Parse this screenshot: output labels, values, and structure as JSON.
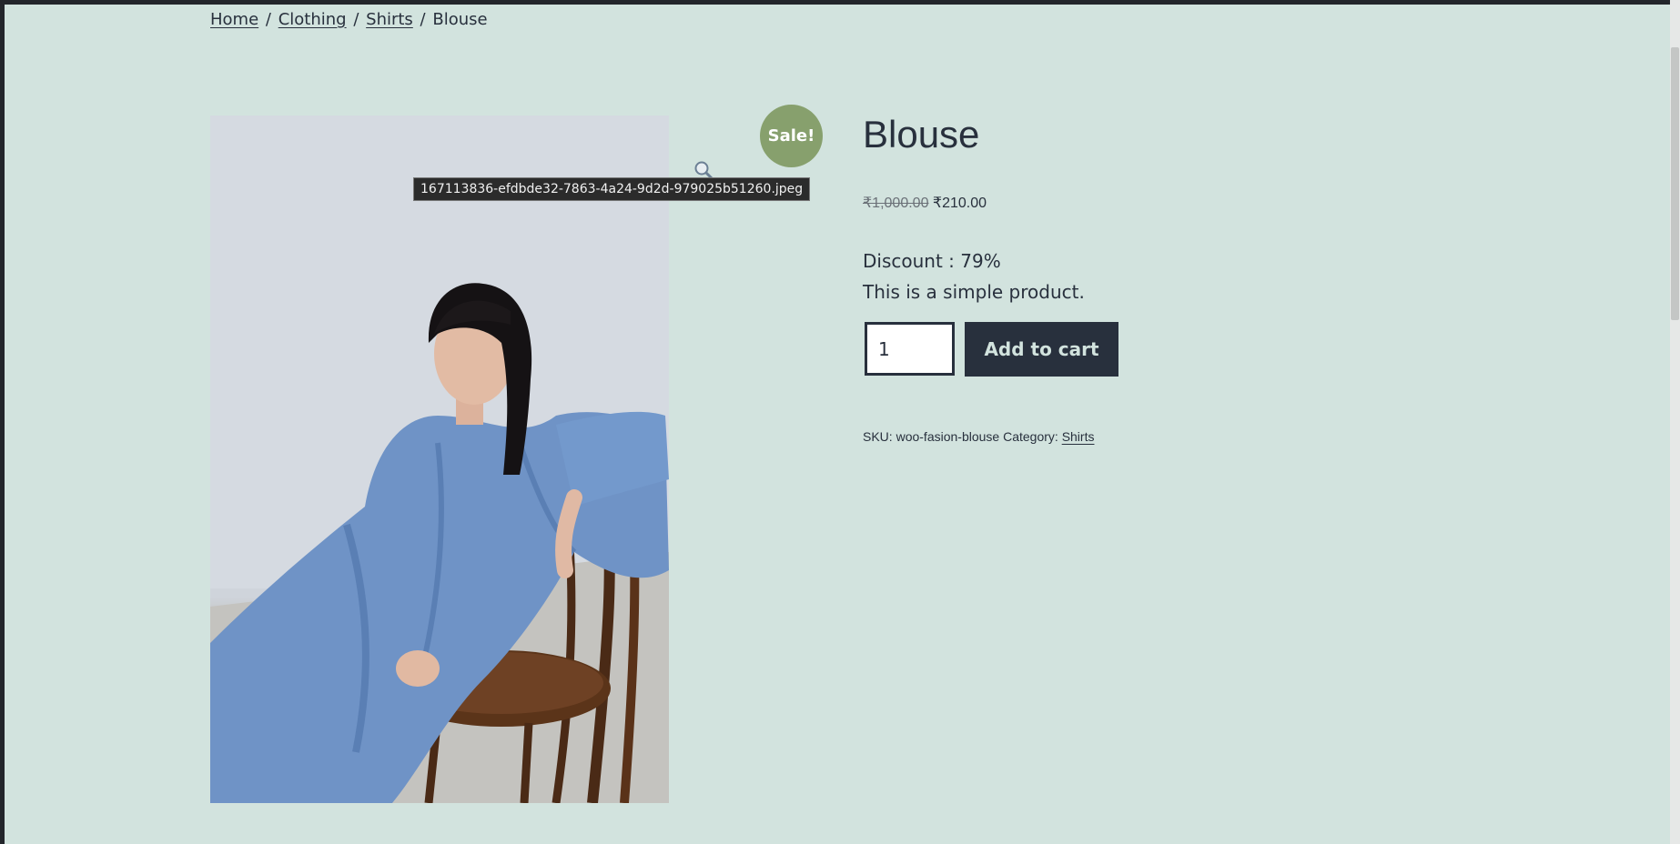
{
  "breadcrumb": {
    "home": "Home",
    "clothing": "Clothing",
    "shirts": "Shirts",
    "current": "Blouse",
    "separator": "/"
  },
  "product": {
    "title": "Blouse",
    "sale_badge": "Sale!",
    "price_regular": "₹1,000.00",
    "price_sale": "₹210.00",
    "discount": "Discount : 79%",
    "short_description": "This is a simple product.",
    "quantity": "1",
    "add_to_cart_label": "Add to cart",
    "sku_label": "SKU:",
    "sku": "woo-fasion-blouse",
    "category_label": "Category:",
    "category": "Shirts"
  },
  "image": {
    "tooltip": "167113836-efdbde32-7863-4a24-9d2d-979025b51260.jpeg"
  },
  "icons": {
    "zoom": "magnifier-icon"
  },
  "colors": {
    "background": "#d2e3de",
    "text": "#28303d",
    "sale_badge": "#87a06d",
    "button_bg": "#28303d",
    "button_text": "#d2e3de"
  }
}
